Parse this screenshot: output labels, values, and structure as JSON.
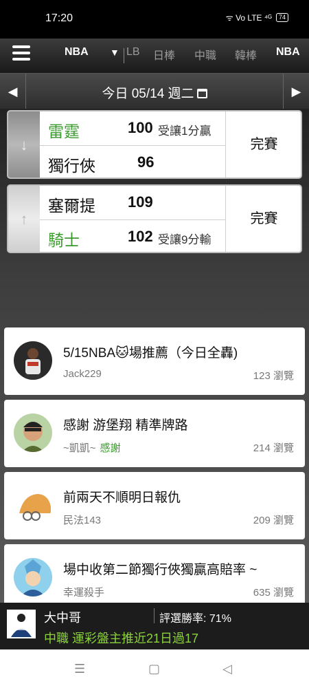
{
  "status_bar": {
    "time": "17:20",
    "icons": "ᯤ Vo LTE ⁴ᴳ",
    "battery": "74"
  },
  "nav": {
    "tabs": [
      {
        "label": "NBA"
      },
      {
        "label": "LB"
      },
      {
        "label": "日棒"
      },
      {
        "label": "中職"
      },
      {
        "label": "韓棒"
      },
      {
        "label": "NBA"
      }
    ]
  },
  "date_bar": {
    "label": "今日 05/14 週二"
  },
  "games": [
    {
      "teams": [
        {
          "name": "雷霆",
          "score": "100",
          "handicap": "受讓1分贏"
        },
        {
          "name": "獨行俠",
          "score": "96",
          "handicap": ""
        }
      ],
      "status": "完賽"
    },
    {
      "teams": [
        {
          "name": "塞爾提",
          "score": "109",
          "handicap": ""
        },
        {
          "name": "騎士",
          "score": "102",
          "handicap": "受讓9分輸"
        }
      ],
      "status": "完賽"
    }
  ],
  "posts": [
    {
      "title": "5/15NBA🐱場推薦（今日全轟)",
      "author": "Jack229",
      "tag": "",
      "views": "123 瀏覽"
    },
    {
      "title": "感謝 游堡翔 精準牌路",
      "author": "~凱凱~",
      "tag": "感謝",
      "views": "214 瀏覽"
    },
    {
      "title": "前兩天不順明日報仇",
      "author": "民法143",
      "tag": "",
      "views": "209 瀏覽"
    },
    {
      "title": "場中收第二節獨行俠獨贏高賠率 ~",
      "author": "幸運殺手",
      "tag": "",
      "views": "635 瀏覽"
    }
  ],
  "expert": {
    "name": "大中哥",
    "win_rate": "評選勝率: 71%",
    "pick": "中職 運彩盤主推近21日過17"
  },
  "colors": {
    "accent_green": "#3a9a2e",
    "pick_green": "#8bd33b"
  }
}
